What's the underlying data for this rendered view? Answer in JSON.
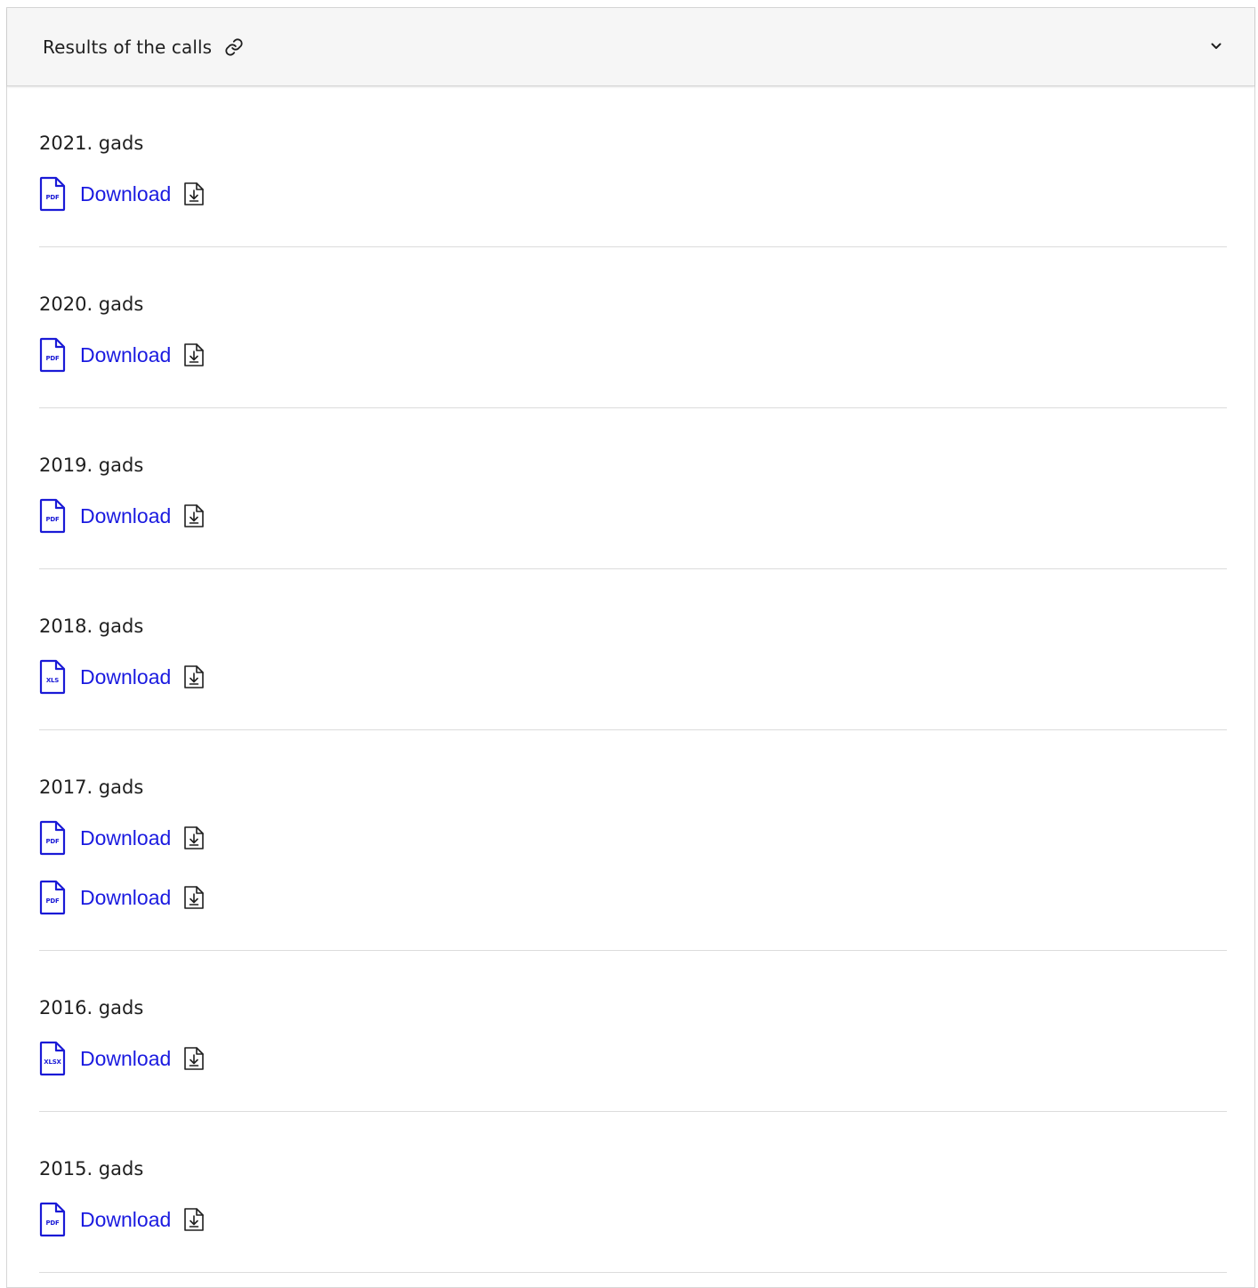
{
  "accordion": {
    "title": "Results of the calls",
    "link_icon": "link-icon",
    "toggle_icon": "chevron-down-icon"
  },
  "sections": [
    {
      "year": "2021. gads",
      "files": [
        {
          "ext": "PDF",
          "label": "Download"
        }
      ]
    },
    {
      "year": "2020. gads",
      "files": [
        {
          "ext": "PDF",
          "label": "Download"
        }
      ]
    },
    {
      "year": "2019. gads",
      "files": [
        {
          "ext": "PDF",
          "label": "Download"
        }
      ]
    },
    {
      "year": "2018. gads",
      "files": [
        {
          "ext": "XLS",
          "label": "Download"
        }
      ]
    },
    {
      "year": "2017. gads",
      "files": [
        {
          "ext": "PDF",
          "label": "Download"
        },
        {
          "ext": "PDF",
          "label": "Download"
        }
      ]
    },
    {
      "year": "2016. gads",
      "files": [
        {
          "ext": "XLSX",
          "label": "Download"
        }
      ]
    },
    {
      "year": "2015. gads",
      "files": [
        {
          "ext": "PDF",
          "label": "Download"
        }
      ]
    }
  ],
  "colors": {
    "link": "#1a1ae0",
    "file_icon": "#1a1ad6",
    "header_bg": "#f6f6f6",
    "divider": "#dcdcdc"
  }
}
